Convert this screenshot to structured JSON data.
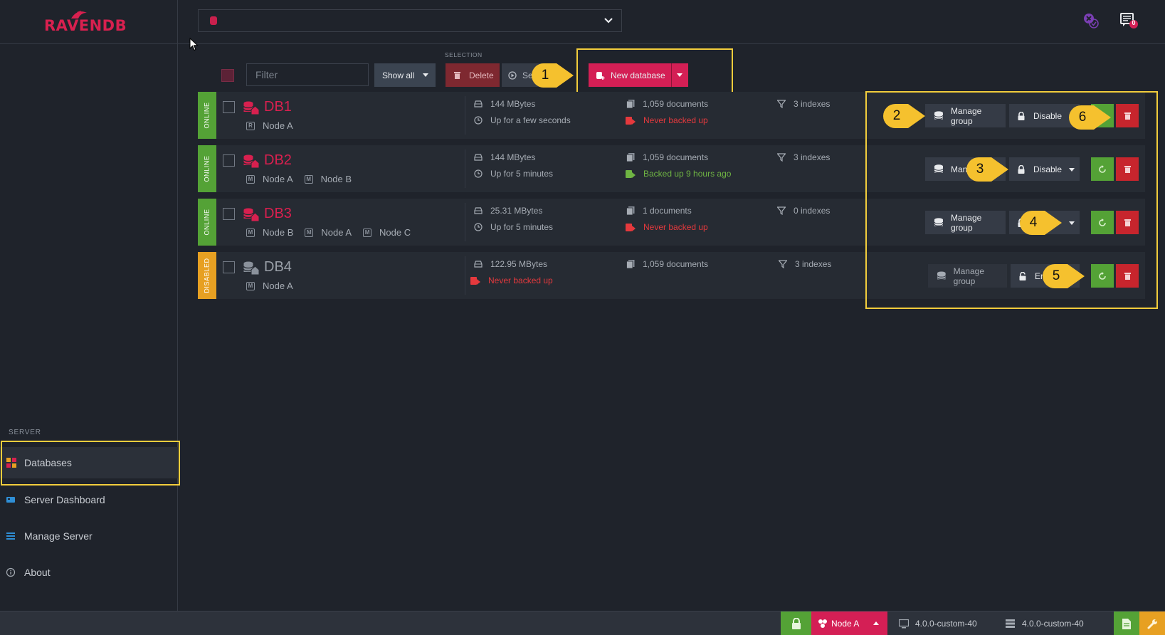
{
  "app": {
    "logo_text": "RAVENDB",
    "accent_color": "#d41f55"
  },
  "sidebar": {
    "section_label": "SERVER",
    "items": [
      {
        "label": "Databases",
        "icon": "databases-grid-icon",
        "active": true
      },
      {
        "label": "Server Dashboard",
        "icon": "dashboard-icon",
        "active": false
      },
      {
        "label": "Manage Server",
        "icon": "manage-server-icon",
        "active": false
      },
      {
        "label": "About",
        "icon": "info-icon",
        "active": false
      }
    ]
  },
  "header": {
    "database_selector_value": "",
    "notification_count": "0"
  },
  "toolbar": {
    "filter_placeholder": "Filter",
    "show_all_label": "Show all",
    "selection_label": "SELECTION",
    "delete_label": "Delete",
    "set_label": "Se",
    "new_database_label": "New database"
  },
  "databases": [
    {
      "status": "ONLINE",
      "status_color": "#54a236",
      "name": "DB1",
      "nodes": [
        {
          "badge": "R",
          "label": "Node A"
        }
      ],
      "size": "144 MBytes",
      "uptime": "Up for a few seconds",
      "documents": "1,059 documents",
      "backup": "Never backed up",
      "indexes": "3 indexes",
      "manage_label": "Manage group",
      "toggle_label": "Disable"
    },
    {
      "status": "ONLINE",
      "status_color": "#54a236",
      "name": "DB2",
      "nodes": [
        {
          "badge": "M",
          "label": "Node A"
        },
        {
          "badge": "M",
          "label": "Node B"
        }
      ],
      "size": "144 MBytes",
      "uptime": "Up for 5 minutes",
      "documents": "1,059 documents",
      "backup": "Backed up 9 hours ago",
      "indexes": "3 indexes",
      "manage_label": "Mana",
      "toggle_label": "Disable"
    },
    {
      "status": "ONLINE",
      "status_color": "#54a236",
      "name": "DB3",
      "nodes": [
        {
          "badge": "M",
          "label": "Node B"
        },
        {
          "badge": "M",
          "label": "Node A"
        },
        {
          "badge": "M",
          "label": "Node C"
        }
      ],
      "size": "25.31 MBytes",
      "uptime": "Up for 5 minutes",
      "documents": "1 documents",
      "backup": "Never backed up",
      "indexes": "0 indexes",
      "manage_label": "Manage group",
      "toggle_label": ""
    },
    {
      "status": "DISABLED",
      "status_color": "#e7a022",
      "name": "DB4",
      "nodes": [
        {
          "badge": "M",
          "label": "Node A"
        }
      ],
      "size": "122.95 MBytes",
      "backup": "Never backed up",
      "documents": "1,059 documents",
      "indexes": "3 indexes",
      "manage_label": "Manage group",
      "toggle_label": "En"
    }
  ],
  "callouts": [
    "1",
    "2",
    "3",
    "4",
    "5",
    "6"
  ],
  "footer": {
    "node_label": "Node A",
    "version_server": "4.0.0-custom-40",
    "version_studio": "4.0.0-custom-40"
  }
}
